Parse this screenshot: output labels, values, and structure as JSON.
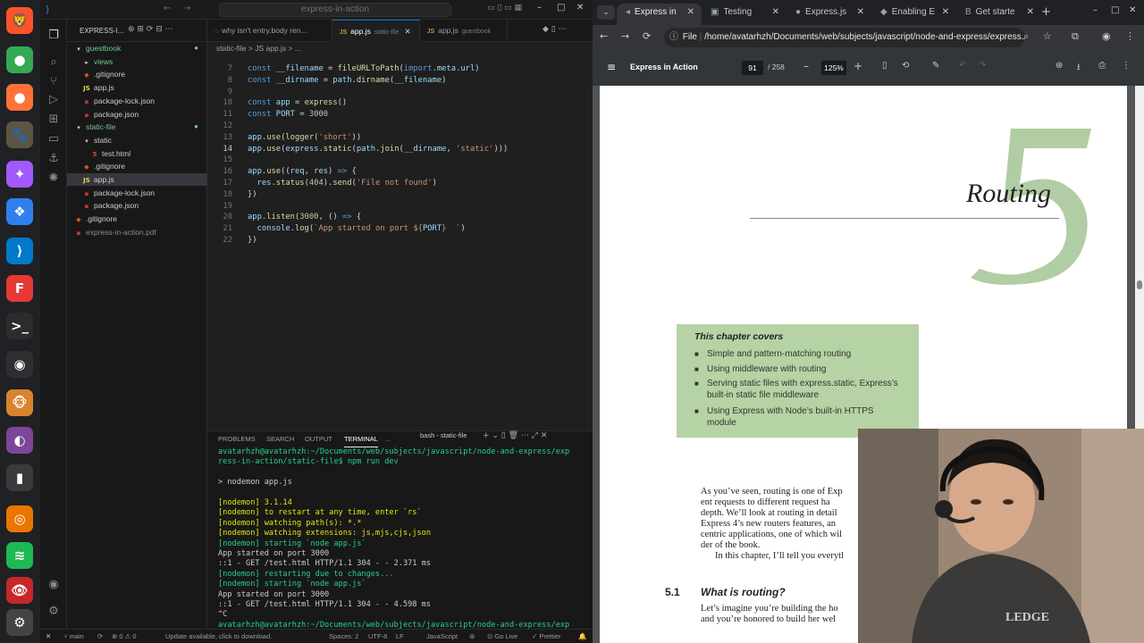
{
  "dock": {
    "apps": [
      {
        "name": "brave-icon",
        "color": "#fb542b",
        "glyph": "🦁"
      },
      {
        "name": "chrome-icon",
        "color": "#34a853",
        "glyph": "●"
      },
      {
        "name": "firefox-icon",
        "color": "#ff7139",
        "glyph": "●"
      },
      {
        "name": "gimp-icon",
        "color": "#5c5543",
        "glyph": "🐾"
      },
      {
        "name": "figma-icon",
        "color": "#a259ff",
        "glyph": "✦"
      },
      {
        "name": "vscodium-icon",
        "color": "#2f80ed",
        "glyph": "❖"
      },
      {
        "name": "vscode-icon",
        "color": "#007acc",
        "glyph": "⟩"
      },
      {
        "name": "freetube-icon",
        "color": "#e53935",
        "glyph": "F"
      },
      {
        "name": "terminal-icon",
        "color": "#2c2c2c",
        "glyph": ">_"
      },
      {
        "name": "obs-icon",
        "color": "#302e31",
        "glyph": "◉"
      },
      {
        "name": "gitkraken-icon",
        "color": "#d9832e",
        "glyph": "🐵"
      },
      {
        "name": "tor-icon",
        "color": "#7d4698",
        "glyph": "◐"
      },
      {
        "name": "files-icon",
        "color": "#3a3a3a",
        "glyph": "▮"
      },
      {
        "name": "blender-icon",
        "color": "#ea7600",
        "glyph": "◎"
      },
      {
        "name": "spotify-icon",
        "color": "#1db954",
        "glyph": "≋"
      },
      {
        "name": "eye-icon",
        "color": "#c62828",
        "glyph": "👁"
      },
      {
        "name": "settings-icon",
        "color": "#444",
        "glyph": "⚙"
      }
    ]
  },
  "vscode": {
    "command_center": "express-in-action",
    "explorer": {
      "title": "EXPRESS-I...",
      "items": [
        {
          "label": "guestbook",
          "type": "folder-open",
          "depth": 0,
          "color": "#73c991",
          "dot": true
        },
        {
          "label": "views",
          "type": "folder",
          "depth": 1,
          "color": "#73c991"
        },
        {
          "label": ".gitignore",
          "type": "git",
          "depth": 1,
          "color": "#cccccc"
        },
        {
          "label": "app.js",
          "type": "js",
          "depth": 1,
          "color": "#cccccc"
        },
        {
          "label": "package-lock.json",
          "type": "npm",
          "depth": 1,
          "color": "#cccccc"
        },
        {
          "label": "package.json",
          "type": "npm",
          "depth": 1,
          "color": "#cccccc"
        },
        {
          "label": "static-file",
          "type": "folder-open",
          "depth": 0,
          "color": "#73c991",
          "dot": true
        },
        {
          "label": "static",
          "type": "folder-open",
          "depth": 1,
          "color": "#cccccc"
        },
        {
          "label": "test.html",
          "type": "html",
          "depth": 2,
          "color": "#cccccc"
        },
        {
          "label": ".gitignore",
          "type": "git",
          "depth": 1,
          "color": "#cccccc"
        },
        {
          "label": "app.js",
          "type": "js",
          "depth": 1,
          "color": "#cccccc",
          "selected": true
        },
        {
          "label": "package-lock.json",
          "type": "npm",
          "depth": 1,
          "color": "#cccccc"
        },
        {
          "label": "package.json",
          "type": "npm",
          "depth": 1,
          "color": "#cccccc"
        },
        {
          "label": ".gitignore",
          "type": "git",
          "depth": 0,
          "color": "#cccccc"
        },
        {
          "label": "express-in-action.pdf",
          "type": "pdf",
          "depth": 0,
          "color": "#8a8a8a"
        }
      ]
    },
    "tabs": [
      {
        "label": "why isn't entry.body ren...",
        "sub": "",
        "active": false,
        "icon": "chat"
      },
      {
        "label": "app.js",
        "sub": "static-file",
        "active": true,
        "icon": "JS"
      },
      {
        "label": "app.js",
        "sub": "guestbook",
        "active": false,
        "icon": "JS"
      }
    ],
    "breadcrumb": "static-file  >  JS  app.js  >  ...",
    "code": [
      {
        "n": "7",
        "html": "<span class='k'>const</span> <span class='v'>__filename</span> = <span class='f'>fileURLToPath</span>(<span class='k'>import</span>.<span class='v'>meta</span>.<span class='v'>url</span>)"
      },
      {
        "n": "8",
        "html": "<span class='k'>const</span> <span class='v'>__dirname</span> = <span class='v'>path</span>.<span class='f'>dirname</span>(<span class='v'>__filename</span>)"
      },
      {
        "n": "9",
        "html": ""
      },
      {
        "n": "10",
        "html": "<span class='k'>const</span> <span class='v'>app</span> = <span class='f'>express</span>()"
      },
      {
        "n": "11",
        "html": "<span class='k'>const</span> <span class='v'>PORT</span> = <span class='n'>3000</span>"
      },
      {
        "n": "12",
        "html": ""
      },
      {
        "n": "13",
        "html": "<span class='v'>app</span>.<span class='f'>use</span>(<span class='f'>logger</span>(<span class='s'>'short'</span>))"
      },
      {
        "n": "14",
        "html": "<span class='v'>app</span>.<span class='f'>use</span>(<span class='v'>express</span>.<span class='f'>static</span>(<span class='v'>path</span>.<span class='f'>join</span>(<span class='v'>__dirname</span>, <span class='s'>'static'</span>)))",
        "current": true
      },
      {
        "n": "15",
        "html": ""
      },
      {
        "n": "16",
        "html": "<span class='v'>app</span>.<span class='f'>use</span>((<span class='v'>req</span>, <span class='v'>res</span>) <span class='k'>=&gt;</span> {"
      },
      {
        "n": "17",
        "html": "  <span class='v'>res</span>.<span class='f'>status</span>(<span class='n'>404</span>).<span class='f'>send</span>(<span class='s'>'File not found'</span>)"
      },
      {
        "n": "18",
        "html": "})"
      },
      {
        "n": "19",
        "html": ""
      },
      {
        "n": "20",
        "html": "<span class='v'>app</span>.<span class='f'>listen</span>(<span class='n'>3000</span>, () <span class='k'>=&gt;</span> {"
      },
      {
        "n": "21",
        "html": "  <span class='v'>console</span>.<span class='f'>log</span>(<span class='s'>`App started on port ${</span><span class='v'>PORT</span><span class='s'>}  `</span>)"
      },
      {
        "n": "22",
        "html": "})"
      }
    ],
    "panel_tabs": [
      "PROBLEMS",
      "SEARCH",
      "OUTPUT",
      "TERMINAL",
      "..."
    ],
    "terminal_label": "bash - static-file",
    "terminal": [
      {
        "t": "avatarhzh@avatarhzh:~/Documents/web/subjects/javascript/node-and-express/exp",
        "c": "tg"
      },
      {
        "t": "ress-in-action/static-file$ npm run dev",
        "c": "tg"
      },
      {
        "t": "",
        "c": ""
      },
      {
        "t": "> nodemon app.js",
        "c": ""
      },
      {
        "t": "",
        "c": ""
      },
      {
        "t": "[nodemon] 3.1.14",
        "c": "ty"
      },
      {
        "t": "[nodemon] to restart at any time, enter `rs`",
        "c": "ty"
      },
      {
        "t": "[nodemon] watching path(s): *.*",
        "c": "ty"
      },
      {
        "t": "[nodemon] watching extensions: js,mjs,cjs,json",
        "c": "ty"
      },
      {
        "t": "[nodemon] starting `node app.js`",
        "c": "tg"
      },
      {
        "t": "App started on port 3000",
        "c": ""
      },
      {
        "t": "::1 - GET /test.html HTTP/1.1 304 - - 2.371 ms",
        "c": ""
      },
      {
        "t": "[nodemon] restarting due to changes...",
        "c": "tg"
      },
      {
        "t": "[nodemon] starting `node app.js`",
        "c": "tg"
      },
      {
        "t": "App started on port 3000",
        "c": ""
      },
      {
        "t": "::1 - GET /test.html HTTP/1.1 304 - - 4.598 ms",
        "c": ""
      },
      {
        "t": "^C",
        "c": ""
      },
      {
        "t": "avatarhzh@avatarhzh:~/Documents/web/subjects/javascript/node-and-express/exp",
        "c": "tg"
      },
      {
        "t": "ress-in-action/static-file$ ",
        "c": "tg"
      }
    ],
    "status": {
      "branch": "main",
      "problems": "0 ⚠ 0",
      "update": "Update available, click to download.",
      "spaces": "Spaces: 2",
      "encoding": "UTF-8",
      "eol": "LF",
      "language": "JavaScript",
      "golive": "Go Live",
      "prettier": "Prettier"
    }
  },
  "browser": {
    "tabs": [
      {
        "label": "Express in",
        "active": true,
        "icon": "◂"
      },
      {
        "label": "Testing",
        "active": false,
        "icon": "▣"
      },
      {
        "label": "Express.js",
        "active": false,
        "icon": "●"
      },
      {
        "label": "Enabling E",
        "active": false,
        "icon": "◆"
      },
      {
        "label": "Get starte",
        "active": false,
        "icon": "B"
      }
    ],
    "url_scheme": "File",
    "url": "/home/avatarhzh/Documents/web/subjects/javascript/node-and-express/express...",
    "pdf": {
      "title": "Express in Action",
      "page": "91",
      "pages": "/ 258",
      "zoom": "125%"
    },
    "page": {
      "chapter_number": "5",
      "chapter_title": "Routing",
      "covers_heading": "This chapter covers",
      "covers": [
        "Simple and pattern-matching routing",
        "Using middleware with routing",
        "Serving static files with express.static, Express’s built-in static file middleware",
        "Using Express with Node’s built-in HTTPS module"
      ],
      "body_lines": [
        "As you’ve seen, routing is one of Exp",
        "ent requests to different request ha",
        "depth. We’ll look at routing in detail",
        "Express 4’s new routers features, an",
        "centric applications, one of which wil",
        "der of the book."
      ],
      "body_indent": "In this chapter, I’ll tell you everytl",
      "section_number": "5.1",
      "section_title": "What is routing?",
      "section_lines": [
        "Let’s imagine you’re building the ho",
        "and you’re honored to build her wel"
      ]
    }
  },
  "webcam": {
    "label": "LEDGE"
  }
}
